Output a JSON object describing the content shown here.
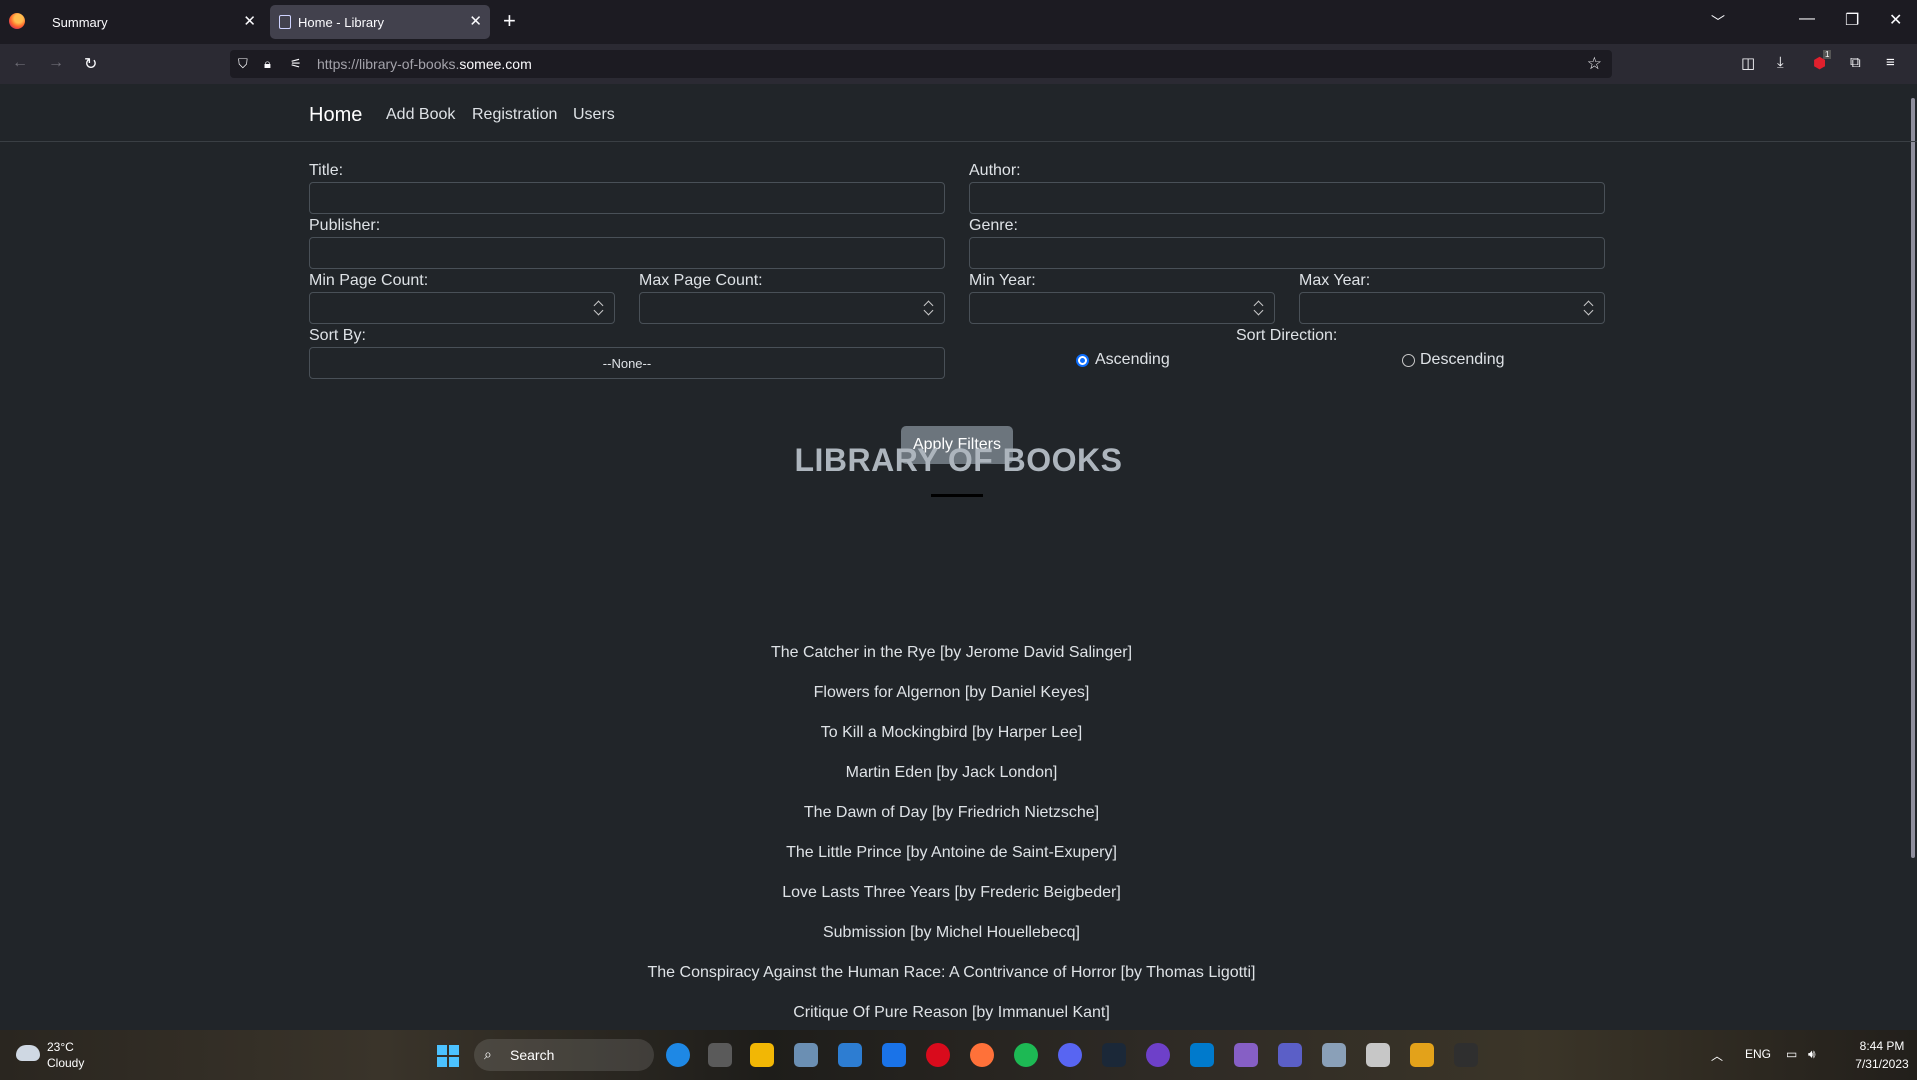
{
  "browser": {
    "tabs": [
      {
        "title": "Summary",
        "active": false
      },
      {
        "title": "Home - Library",
        "active": true
      }
    ],
    "url_prefix": "https://library-of-books.",
    "url_domain": "somee.com",
    "extension_badge": "1"
  },
  "site": {
    "brand": "Home",
    "nav": [
      "Add Book",
      "Registration",
      "Users"
    ]
  },
  "filters": {
    "title_label": "Title:",
    "author_label": "Author:",
    "publisher_label": "Publisher:",
    "genre_label": "Genre:",
    "min_pages_label": "Min Page Count:",
    "max_pages_label": "Max Page Count:",
    "min_year_label": "Min Year:",
    "max_year_label": "Max Year:",
    "sort_by_label": "Sort By:",
    "sort_by_value": "--None--",
    "sort_direction_label": "Sort Direction:",
    "ascending_label": "Ascending",
    "descending_label": "Descending",
    "selected_direction": "Ascending",
    "apply_label": "Apply Filters"
  },
  "library": {
    "heading": "LIBRARY OF BOOKS",
    "books": [
      "The Catcher in the Rye [by Jerome David Salinger]",
      "Flowers for Algernon [by Daniel Keyes]",
      "To Kill a Mockingbird [by Harper Lee]",
      "Martin Eden [by Jack London]",
      "The Dawn of Day [by Friedrich Nietzsche]",
      "The Little Prince [by Antoine de Saint-Exupery]",
      "Love Lasts Three Years [by Frederic Beigbeder]",
      "Submission [by Michel Houellebecq]",
      "The Conspiracy Against the Human Race: A Contrivance of Horror [by Thomas Ligotti]",
      "Critique Of Pure Reason [by Immanuel Kant]"
    ]
  },
  "taskbar": {
    "weather_temp": "23°C",
    "weather_desc": "Cloudy",
    "search_label": "Search",
    "language": "ENG",
    "time": "8:44 PM",
    "date": "7/31/2023",
    "accent_color": "#4cc2ff"
  }
}
